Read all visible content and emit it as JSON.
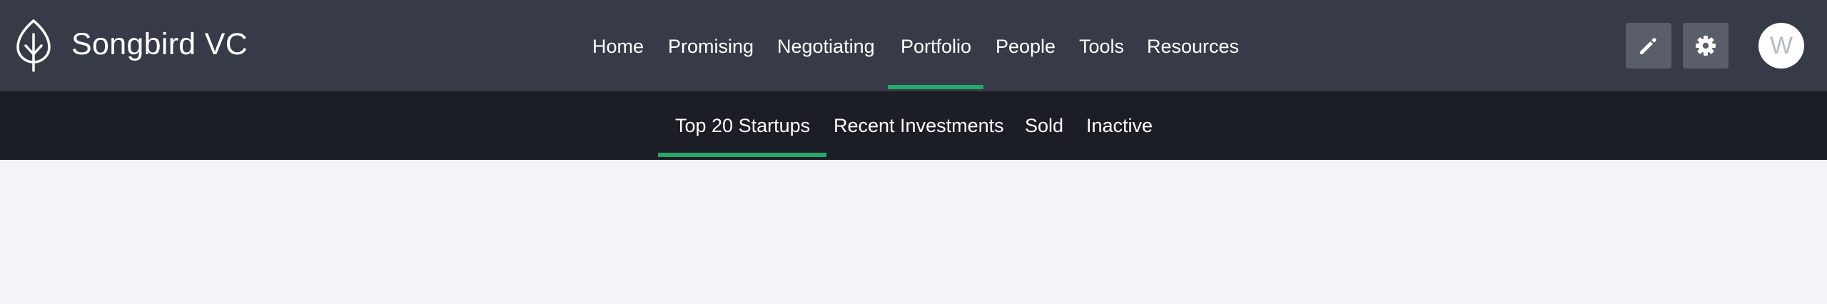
{
  "brand": {
    "name": "Songbird VC",
    "logo_icon": "leaf-icon"
  },
  "main_nav": {
    "items": [
      {
        "label": "Home"
      },
      {
        "label": "Promising"
      },
      {
        "label": "Negotiating"
      },
      {
        "label": "Portfolio",
        "active": true
      },
      {
        "label": "People"
      },
      {
        "label": "Tools"
      },
      {
        "label": "Resources"
      }
    ]
  },
  "actions": {
    "edit_icon": "pencil-icon",
    "settings_icon": "gear-icon"
  },
  "user": {
    "avatar_initial": "W"
  },
  "sub_nav": {
    "items": [
      {
        "label": "Top 20 Startups",
        "active": true
      },
      {
        "label": "Recent Investments"
      },
      {
        "label": "Sold"
      },
      {
        "label": "Inactive"
      }
    ]
  },
  "colors": {
    "topbar_bg": "#363b47",
    "subbar_bg": "#1c1e26",
    "accent": "#27a86a",
    "page_bg": "#f3f4f8",
    "icon_button_bg": "#5a5e69"
  }
}
